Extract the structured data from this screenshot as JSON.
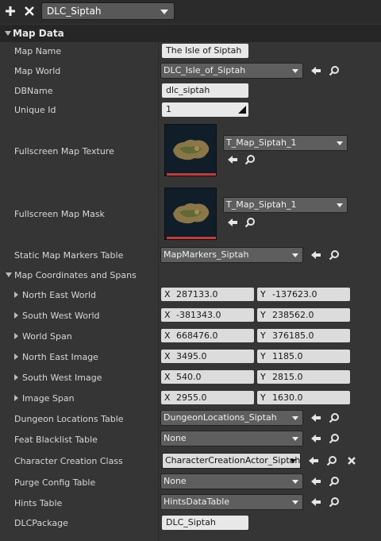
{
  "toolbar": {
    "add_icon": "plus-icon",
    "remove_icon": "x-icon",
    "selected_asset": "DLC_Siptah"
  },
  "section": {
    "title": "Map Data"
  },
  "fields": {
    "map_name": {
      "label": "Map Name",
      "value": "The Isle of Siptah"
    },
    "map_world": {
      "label": "Map World",
      "value": "DLC_Isle_of_Siptah"
    },
    "db_name": {
      "label": "DBName",
      "value": "dlc_siptah"
    },
    "unique_id": {
      "label": "Unique Id",
      "value": "1"
    },
    "fullscreen_texture": {
      "label": "Fullscreen Map Texture",
      "value": "T_Map_Siptah_1"
    },
    "fullscreen_mask": {
      "label": "Fullscreen Map Mask",
      "value": "T_Map_Siptah_1"
    },
    "static_markers": {
      "label": "Static Map Markers Table",
      "value": "MapMarkers_Siptah"
    },
    "coords_group": {
      "label": "Map Coordinates and Spans"
    },
    "north_east_world": {
      "label": "North East World",
      "x": "287133.0",
      "y": "-137623.0"
    },
    "south_west_world": {
      "label": "South West World",
      "x": "-381343.0",
      "y": "238562.0"
    },
    "world_span": {
      "label": "World Span",
      "x": "668476.0",
      "y": "376185.0"
    },
    "north_east_image": {
      "label": "North East Image",
      "x": "3495.0",
      "y": "1185.0"
    },
    "south_west_image": {
      "label": "South West Image",
      "x": "540.0",
      "y": "2815.0"
    },
    "image_span": {
      "label": "Image Span",
      "x": "2955.0",
      "y": "1630.0"
    },
    "dungeon_locations": {
      "label": "Dungeon Locations Table",
      "value": "DungeonLocations_Siptah"
    },
    "feat_blacklist": {
      "label": "Feat Blacklist Table",
      "value": "None"
    },
    "character_creation": {
      "label": "Character Creation Class",
      "value": "CharacterCreationActor_Siptah"
    },
    "purge_config": {
      "label": "Purge Config Table",
      "value": "None"
    },
    "hints_table": {
      "label": "Hints Table",
      "value": "HintsDataTable"
    },
    "dlc_package": {
      "label": "DLCPackage",
      "value": "DLC_Siptah"
    }
  },
  "axis": {
    "x": "X",
    "y": "Y"
  },
  "colors": {
    "panel_bg": "#353535",
    "header_bg": "#262626",
    "text_field": "#e8e8e8",
    "dropdown": "#5e5e5e",
    "thumb_bar": "#c83a3a"
  }
}
